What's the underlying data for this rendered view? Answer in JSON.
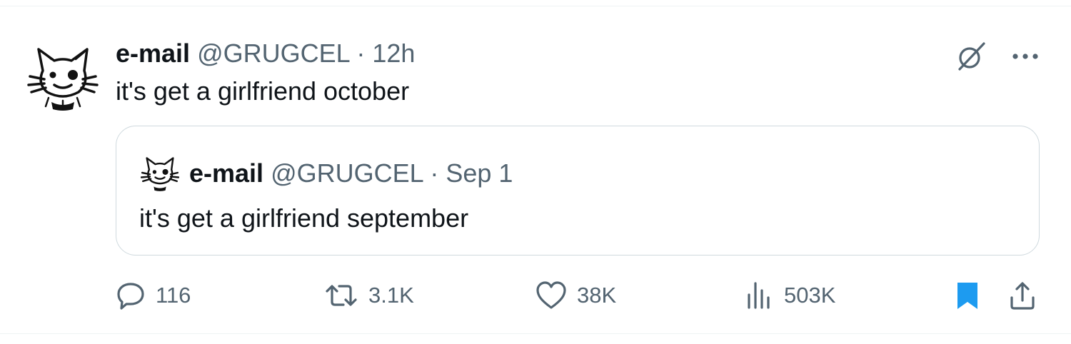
{
  "tweet": {
    "display_name": "e-mail",
    "handle": "@GRUGCEL",
    "separator": "·",
    "time": "12h",
    "text": "it's get a girlfriend october"
  },
  "quote": {
    "display_name": "e-mail",
    "handle": "@GRUGCEL",
    "separator": "·",
    "time": "Sep 1",
    "text": "it's get a girlfriend september"
  },
  "actions": {
    "replies": "116",
    "reposts": "3.1K",
    "likes": "38K",
    "views": "503K"
  },
  "icons": {
    "grok": "grok-icon",
    "more": "more-icon",
    "reply": "reply-icon",
    "repost": "repost-icon",
    "like": "like-icon",
    "views": "views-icon",
    "bookmark": "bookmark-icon",
    "share": "share-icon"
  },
  "colors": {
    "text": "#0f1419",
    "secondary": "#536471",
    "bookmark_active": "#1d9bf0",
    "border": "#cfd9de"
  }
}
